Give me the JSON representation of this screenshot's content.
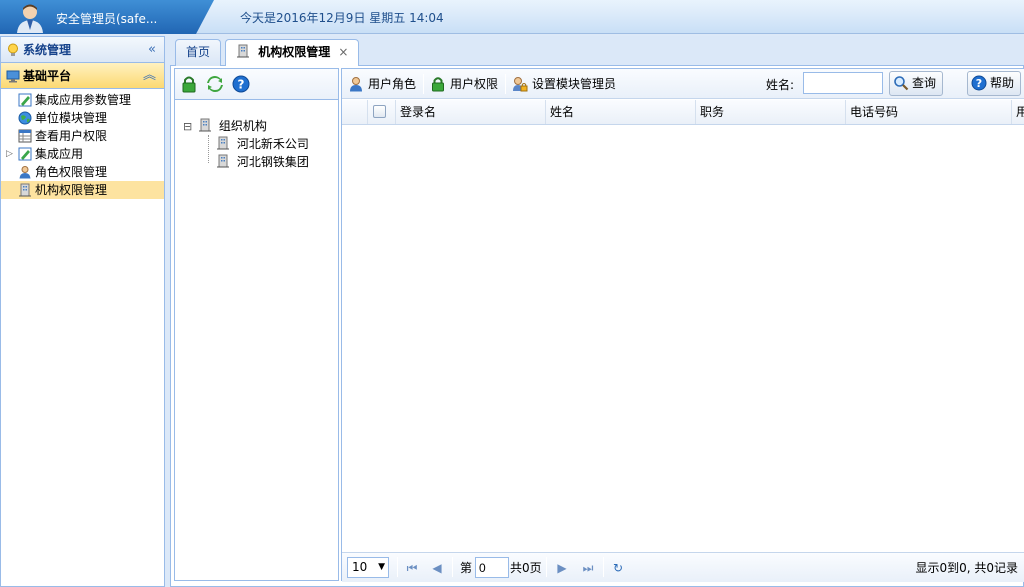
{
  "header": {
    "username": "安全管理员(safe...",
    "datetime": "今天是2016年12月9日   星期五   14:04"
  },
  "sidebar": {
    "sections": [
      {
        "label": "系统管理",
        "collapse_glyph": "«"
      },
      {
        "label": "基础平台",
        "collapse_glyph": "︽"
      }
    ],
    "items": [
      {
        "label": "集成应用参数管理",
        "icon": "edit-form-icon"
      },
      {
        "label": "单位模块管理",
        "icon": "globe-icon"
      },
      {
        "label": "查看用户权限",
        "icon": "table-icon"
      },
      {
        "label": "集成应用",
        "icon": "edit-form-icon",
        "expander": "▷"
      },
      {
        "label": "角色权限管理",
        "icon": "user-icon"
      },
      {
        "label": "机构权限管理",
        "icon": "building-icon"
      }
    ]
  },
  "tabs": [
    {
      "label": "首页"
    },
    {
      "label": "机构权限管理",
      "close": "×"
    }
  ],
  "tree": {
    "toggle": "⊟",
    "root": "组织机构",
    "children": [
      "河北新禾公司",
      "河北钢铁集团"
    ]
  },
  "grid": {
    "toolbar": {
      "user_role": "用户角色",
      "user_perm": "用户权限",
      "set_admin": "设置模块管理员",
      "name_label": "姓名:",
      "name_value": "",
      "query": "查询",
      "help": "帮助"
    },
    "columns": [
      "登录名",
      "姓名",
      "职务",
      "电话号码",
      "用"
    ],
    "rows": []
  },
  "pager": {
    "page_size": "10",
    "page_prefix": "第",
    "page_value": "0",
    "page_suffix": "共0页",
    "info": "显示0到0, 共0记录"
  },
  "colors": {
    "accent": "#2166b3",
    "border": "#99bbe8",
    "selected": "#fde3a0"
  }
}
